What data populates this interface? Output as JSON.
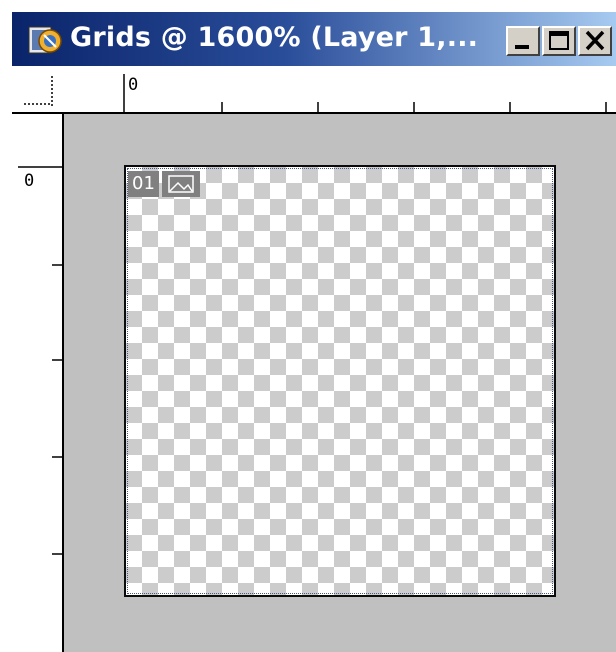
{
  "window": {
    "title": "Grids @ 1600% (Layer 1,...",
    "app_icon": "photoshop-document-icon"
  },
  "controls": {
    "minimize_icon": "minimize-icon",
    "maximize_icon": "maximize-icon",
    "close_icon": "close-icon"
  },
  "rulers": {
    "horizontal_origin_label": "0",
    "vertical_origin_label": "0"
  },
  "document": {
    "transparency": "checkerboard",
    "slice_number": "01",
    "slice_icon": "image-slice-icon"
  },
  "colors": {
    "titlebar_start": "#0a246a",
    "titlebar_end": "#a6caf0",
    "pasteboard": "#c0c0c0",
    "checker_dark": "#cccccc"
  }
}
